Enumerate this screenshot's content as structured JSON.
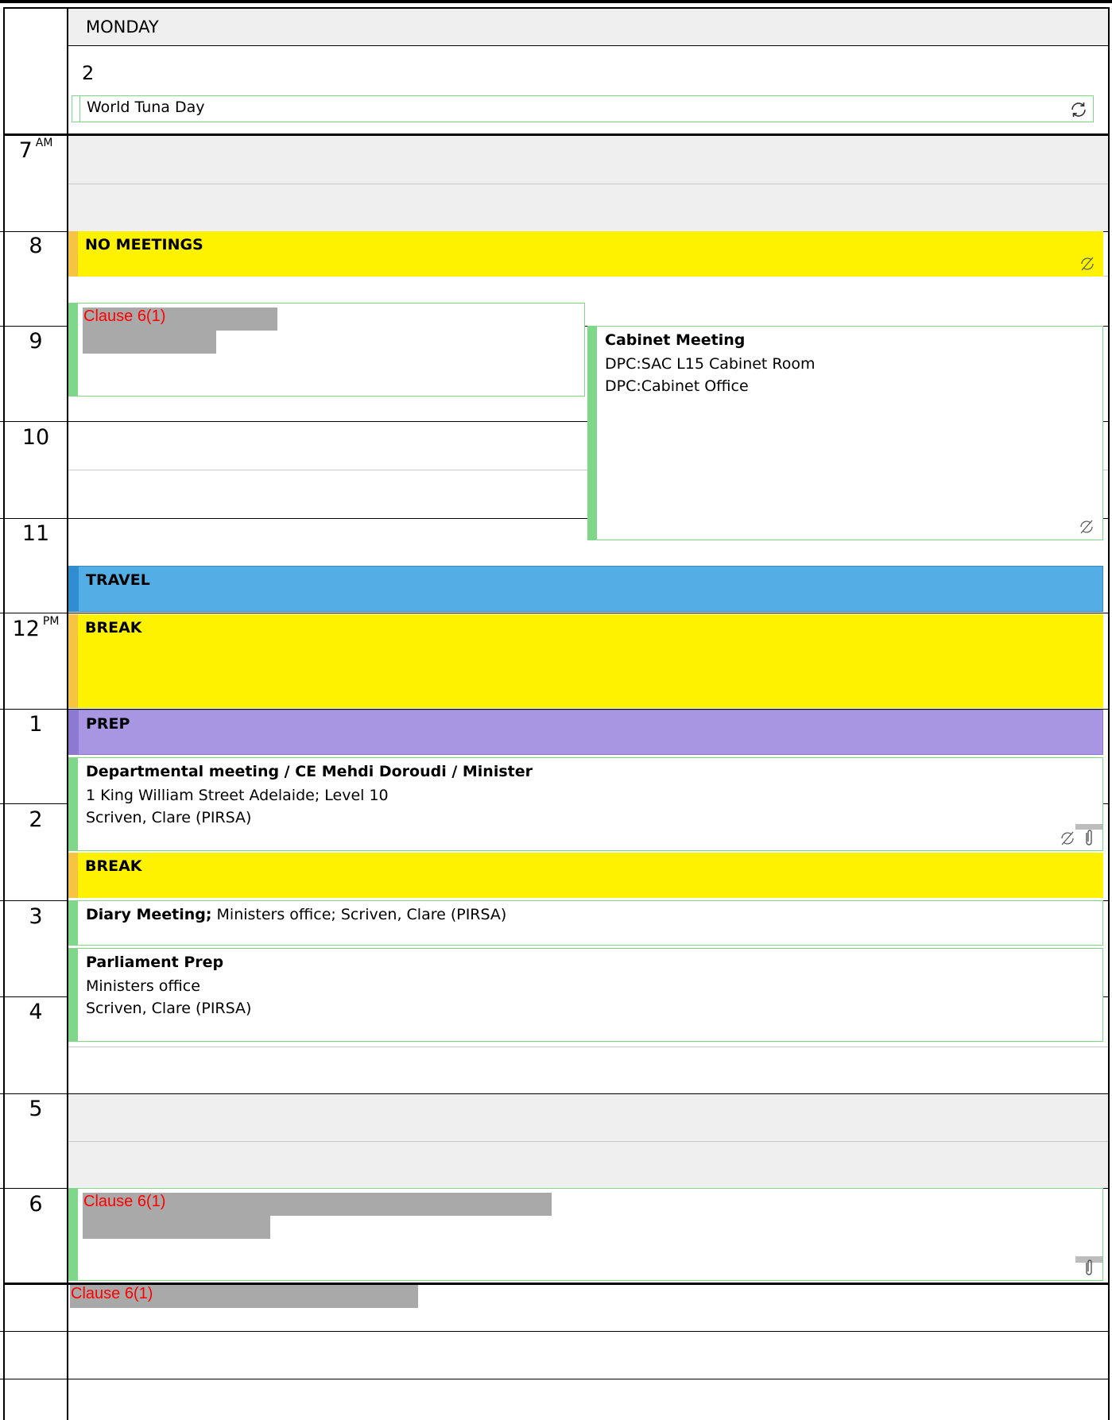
{
  "day": {
    "name": "MONDAY",
    "number": "2"
  },
  "all_day": {
    "title": "World Tuna Day",
    "icon": "recurring-sync-icon"
  },
  "hours": [
    {
      "label": "7",
      "suffix": "AM"
    },
    {
      "label": "8",
      "suffix": ""
    },
    {
      "label": "9",
      "suffix": ""
    },
    {
      "label": "10",
      "suffix": ""
    },
    {
      "label": "11",
      "suffix": ""
    },
    {
      "label": "12",
      "suffix": "PM"
    },
    {
      "label": "1",
      "suffix": ""
    },
    {
      "label": "2",
      "suffix": ""
    },
    {
      "label": "3",
      "suffix": ""
    },
    {
      "label": "4",
      "suffix": ""
    },
    {
      "label": "5",
      "suffix": ""
    },
    {
      "label": "6",
      "suffix": ""
    }
  ],
  "events": {
    "no_meetings": {
      "title": "NO MEETINGS"
    },
    "redacted_9am": {
      "clause": "Clause 6(1)"
    },
    "cabinet": {
      "title": "Cabinet Meeting",
      "line1": "DPC:SAC L15 Cabinet Room",
      "line2": "DPC:Cabinet Office"
    },
    "travel": {
      "title": "TRAVEL"
    },
    "break1": {
      "title": "BREAK"
    },
    "prep": {
      "title": "PREP"
    },
    "departmental": {
      "title": "Departmental meeting / CE Mehdi Doroudi / Minister",
      "line1": "1 King William Street Adelaide; Level 10",
      "line2": "Scriven, Clare (PIRSA)"
    },
    "break2": {
      "title": "BREAK"
    },
    "diary": {
      "title": "Diary Meeting;",
      "rest": " Ministers office; Scriven, Clare (PIRSA)"
    },
    "parliament": {
      "title": "Parliament Prep",
      "line1": "Ministers office",
      "line2": "Scriven, Clare (PIRSA)"
    },
    "redacted_6pm": {
      "clause": "Clause 6(1)"
    },
    "redacted_evening": {
      "clause": "Clause 6(1)"
    }
  },
  "colors": {
    "yellow": "#fff200",
    "blue": "#54aee6",
    "purple": "#a896e2",
    "green_border": "#7fd88a",
    "redaction": "#a9a9a9",
    "clause_red": "#ff0000"
  }
}
